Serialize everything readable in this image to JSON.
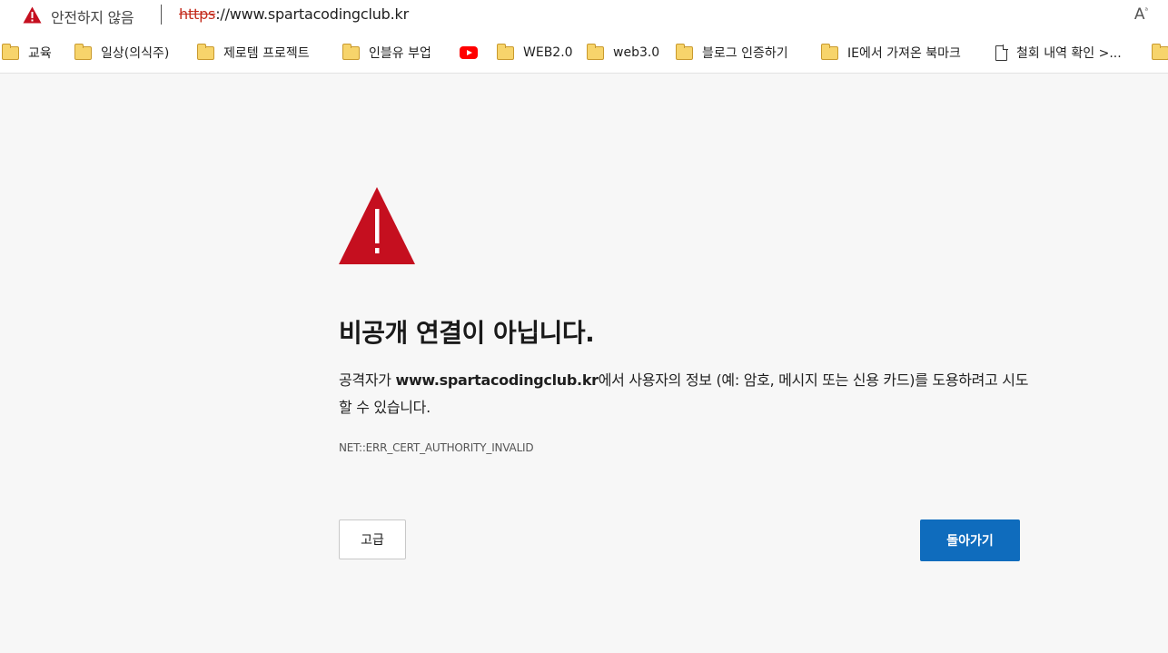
{
  "address_bar": {
    "security_label": "안전하지 않음",
    "url_scheme": "https",
    "url_rest": "://www.spartacodingclub.kr",
    "read_aloud_label": "A",
    "read_aloud_sup": "ᵃ"
  },
  "bookmarks": [
    {
      "label": "교육",
      "icon": "folder-icon"
    },
    {
      "label": "일상(의식주)",
      "icon": "folder-icon"
    },
    {
      "label": "제로템 프로젝트",
      "icon": "folder-icon"
    },
    {
      "label": "인블유 부업",
      "icon": "folder-icon"
    },
    {
      "label": "",
      "icon": "youtube-icon"
    },
    {
      "label": "WEB2.0",
      "icon": "folder-icon"
    },
    {
      "label": "web3.0",
      "icon": "folder-icon"
    },
    {
      "label": "블로그 인증하기",
      "icon": "folder-icon"
    },
    {
      "label": "IE에서 가져온 북마크",
      "icon": "folder-icon"
    },
    {
      "label": "철회 내역 확인 >...",
      "icon": "document-icon"
    },
    {
      "label": "",
      "icon": "folder-icon"
    }
  ],
  "error_page": {
    "title": "비공개 연결이 아닙니다.",
    "desc_prefix": "공격자가 ",
    "desc_host": "www.spartacodingclub.kr",
    "desc_suffix": "에서 사용자의 정보 (예: 암호, 메시지 또는 신용 카드)를 도용하려고 시도할 수 있습니다.",
    "error_code": "NET::ERR_CERT_AUTHORITY_INVALID",
    "advanced_button": "고급",
    "back_button": "돌아가기"
  },
  "colors": {
    "warning_red": "#c50f1f",
    "url_scheme_red": "#c42b1c",
    "primary_button": "#0f6cbd",
    "page_background": "#f7f7f7"
  }
}
